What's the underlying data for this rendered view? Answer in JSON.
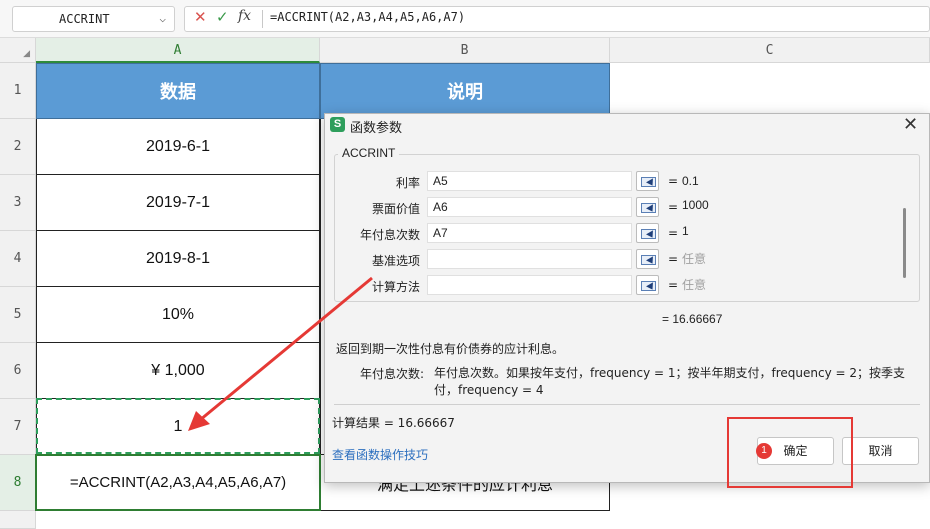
{
  "formula_bar": {
    "name_box": "ACCRINT",
    "cancel_glyph": "✕",
    "confirm_glyph": "✓",
    "fx_glyph": "fx",
    "formula": "=ACCRINT(A2,A3,A4,A5,A6,A7)"
  },
  "sheet": {
    "corner_glyph": "◢",
    "columns": [
      "A",
      "B",
      "C"
    ],
    "rows": [
      "1",
      "2",
      "3",
      "4",
      "5",
      "6",
      "7",
      "8"
    ],
    "header_row": {
      "a": "数据",
      "b": "说明"
    },
    "cells_a": [
      "2019-6-1",
      "2019-7-1",
      "2019-8-1",
      "10%",
      "¥ 1,000",
      "1",
      "=ACCRINT(A2,A3,A4,A5,A6,A7)"
    ],
    "b8": "满足上述条件的应计利息"
  },
  "dialog": {
    "logo_letter": "S",
    "title": "函数参数",
    "close_glyph": "✕",
    "function_name": "ACCRINT",
    "args": [
      {
        "label": "利率",
        "input": "A5",
        "eq": "=",
        "value": "0.1"
      },
      {
        "label": "票面价值",
        "input": "A6",
        "eq": "=",
        "value": "1000"
      },
      {
        "label": "年付息次数",
        "input": "A7",
        "eq": "=",
        "value": "1"
      },
      {
        "label": "基准选项",
        "input": "",
        "eq": "=",
        "value": "任意"
      },
      {
        "label": "计算方法",
        "input": "",
        "eq": "=",
        "value": "任意"
      }
    ],
    "result_preview": "=  16.66667",
    "description": "返回到期一次性付息有价债券的应计利息。",
    "param_label": "年付息次数:",
    "param_desc": "年付息次数。如果按年支付，frequency = 1；按半年期支付，frequency = 2；按季支付，frequency = 4",
    "calc_result": "计算结果  =  16.66667",
    "help_link": "查看函数操作技巧",
    "ok_label": "确定",
    "cancel_label": "取消",
    "badge": "1"
  },
  "colors": {
    "header_fill": "#5b9bd5",
    "accent_green": "#2e7d32",
    "annotation_red": "#e53935"
  },
  "icons": {
    "ref_button": "range-select-icon",
    "close": "close-icon",
    "dropdown": "chevron-down-icon"
  }
}
